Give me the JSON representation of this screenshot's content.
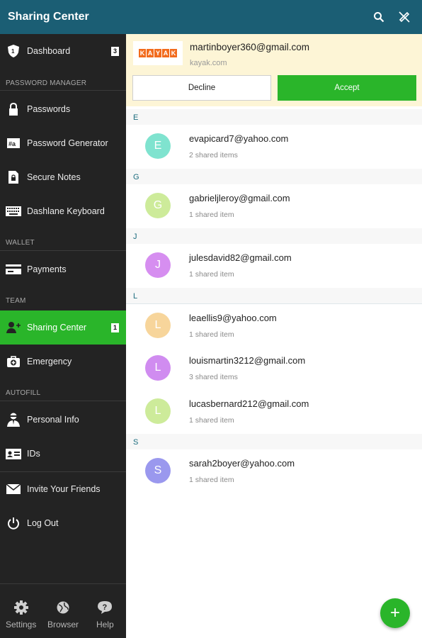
{
  "topbar": {
    "title": "Sharing Center",
    "icons": [
      "search-icon",
      "sync-disabled-icon"
    ]
  },
  "sidebar": {
    "items": [
      {
        "label": "Dashboard",
        "icon": "shield-icon",
        "badge": "3"
      },
      {
        "label": "Passwords",
        "icon": "lock-icon"
      },
      {
        "label": "Password Generator",
        "icon": "generator-icon"
      },
      {
        "label": "Secure Notes",
        "icon": "note-lock-icon"
      },
      {
        "label": "Dashlane Keyboard",
        "icon": "keyboard-icon"
      },
      {
        "label": "Payments",
        "icon": "card-icon"
      },
      {
        "label": "Sharing Center",
        "icon": "sharing-icon",
        "badge": "1"
      },
      {
        "label": "Emergency",
        "icon": "emergency-kit-icon"
      },
      {
        "label": "Personal Info",
        "icon": "person-icon"
      },
      {
        "label": "IDs",
        "icon": "id-card-icon"
      },
      {
        "label": "Invite Your Friends",
        "icon": "envelope-icon"
      },
      {
        "label": "Log Out",
        "icon": "power-icon"
      }
    ],
    "sections": {
      "password_manager": "PASSWORD MANAGER",
      "wallet": "WALLET",
      "team": "TEAM",
      "autofill": "AUTOFILL"
    },
    "bottom": [
      {
        "label": "Settings",
        "icon": "gear-icon"
      },
      {
        "label": "Browser",
        "icon": "globe-icon"
      },
      {
        "label": "Help",
        "icon": "help-icon"
      }
    ]
  },
  "request": {
    "logo_text": "KAYAK",
    "email": "martinboyer360@gmail.com",
    "site": "kayak.com",
    "decline_label": "Decline",
    "accept_label": "Accept"
  },
  "contacts": [
    {
      "letter": "E",
      "initial": "E",
      "email": "evapicard7@yahoo.com",
      "count": "2 shared items",
      "color": "#7fe3cf"
    },
    {
      "letter": "G",
      "initial": "G",
      "email": "gabrieljleroy@gmail.com",
      "count": "1 shared item",
      "color": "#cdeb9a"
    },
    {
      "letter": "J",
      "initial": "J",
      "email": "julesdavid82@gmail.com",
      "count": "1 shared item",
      "color": "#d68ef0"
    },
    {
      "letter": "L",
      "initial": "L",
      "email": "leaellis9@yahoo.com",
      "count": "1 shared item",
      "color": "#f7d59b"
    },
    {
      "letter": "",
      "initial": "L",
      "email": "louismartin3212@gmail.com",
      "count": "3 shared items",
      "color": "#d08cf0"
    },
    {
      "letter": "",
      "initial": "L",
      "email": "lucasbernard212@gmail.com",
      "count": "1 shared item",
      "color": "#cdeb9a"
    },
    {
      "letter": "S",
      "initial": "S",
      "email": "sarah2boyer@yahoo.com",
      "count": "1 shared item",
      "color": "#9a98ee"
    }
  ],
  "fab": {
    "label": "+"
  },
  "colors": {
    "topbar": "#1b5e74",
    "sidebar": "#232323",
    "accent": "#2ab52a",
    "request_bg": "#fdf5d6"
  }
}
